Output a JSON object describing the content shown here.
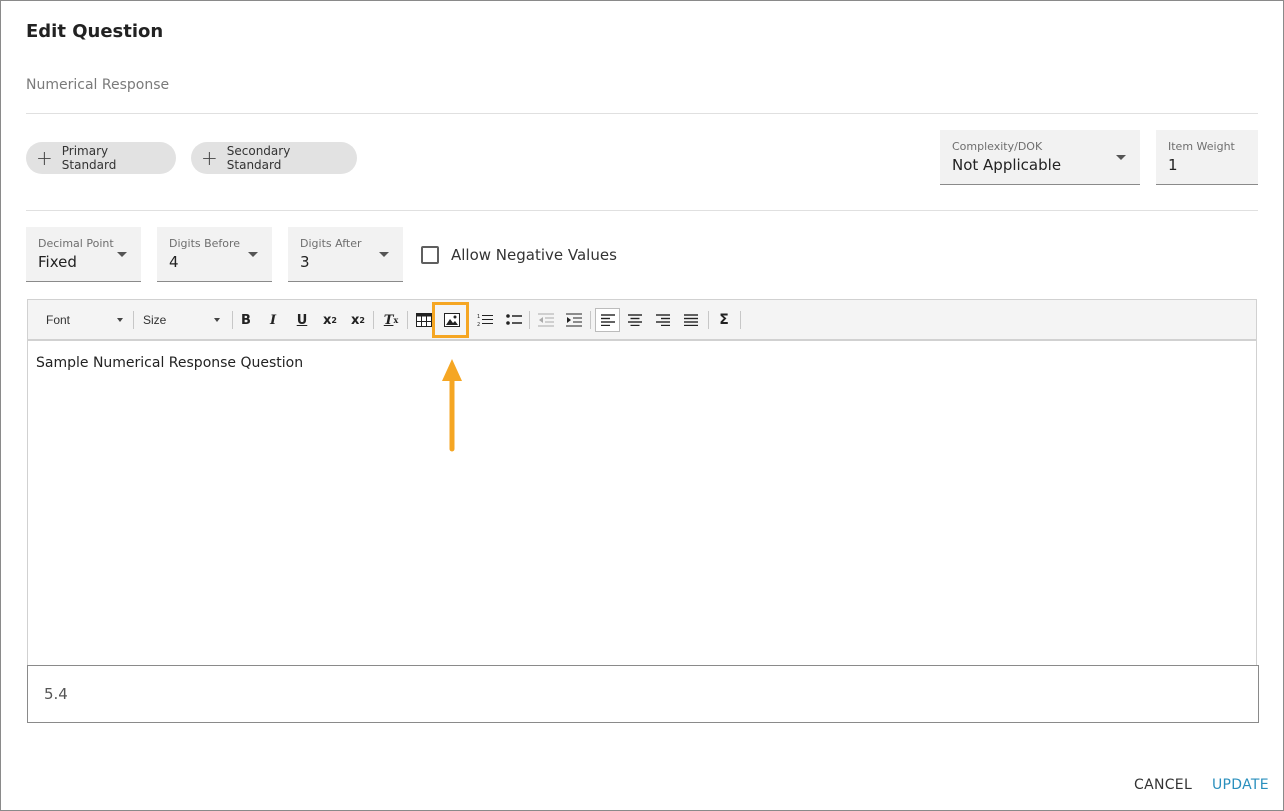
{
  "dialog": {
    "title": "Edit Question",
    "subtitle": "Numerical Response"
  },
  "standards": {
    "primary_label": "Primary Standard",
    "secondary_label": "Secondary Standard"
  },
  "complexity": {
    "label": "Complexity/DOK",
    "value": "Not Applicable"
  },
  "item_weight": {
    "label": "Item Weight",
    "value": "1"
  },
  "decimal_point": {
    "label": "Decimal Point",
    "value": "Fixed"
  },
  "digits_before": {
    "label": "Digits Before",
    "value": "4"
  },
  "digits_after": {
    "label": "Digits After",
    "value": "3"
  },
  "allow_negative": {
    "label": "Allow Negative Values",
    "checked": false
  },
  "toolbar": {
    "font_label": "Font",
    "size_label": "Size",
    "icons": [
      "bold-icon",
      "italic-icon",
      "underline-icon",
      "subscript-icon",
      "superscript-icon",
      "remove-format-icon",
      "table-icon",
      "image-icon",
      "numbered-list-icon",
      "bulleted-list-icon",
      "outdent-icon",
      "indent-icon",
      "align-left-icon",
      "align-center-icon",
      "align-right-icon",
      "justify-icon",
      "math-sigma-icon"
    ],
    "highlighted_icon": "image-icon",
    "highlight_color": "#f5a623"
  },
  "editor": {
    "content": "Sample Numerical Response Question"
  },
  "answer": {
    "value": "5.4"
  },
  "actions": {
    "cancel_label": "CANCEL",
    "update_label": "UPDATE",
    "update_color": "#2a8fbd"
  }
}
